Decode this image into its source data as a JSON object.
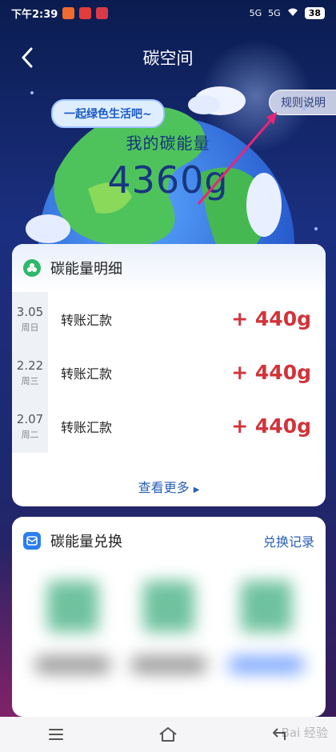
{
  "status_bar": {
    "time": "下午2:39",
    "battery": "38",
    "signal_labels": [
      "5G",
      "5G"
    ]
  },
  "header": {
    "title": "碳空间",
    "rules_label": "规则说明"
  },
  "hero": {
    "speech": "一起绿色生活吧~",
    "energy_label": "我的碳能量",
    "energy_value": "4360g"
  },
  "details": {
    "title": "碳能量明细",
    "rows": [
      {
        "date": "3.05",
        "weekday": "周日",
        "name": "转账汇款",
        "amount": "+ 440g"
      },
      {
        "date": "2.22",
        "weekday": "周三",
        "name": "转账汇款",
        "amount": "+ 440g"
      },
      {
        "date": "2.07",
        "weekday": "周二",
        "name": "转账汇款",
        "amount": "+ 440g"
      }
    ],
    "more_label": "查看更多"
  },
  "exchange": {
    "title": "碳能量兑换",
    "link_label": "兑换记录"
  },
  "watermark": "Bai 经验",
  "colors": {
    "accent_blue": "#2a5fb8",
    "amount_red": "#d2333a",
    "arrow": "#e8257a"
  }
}
